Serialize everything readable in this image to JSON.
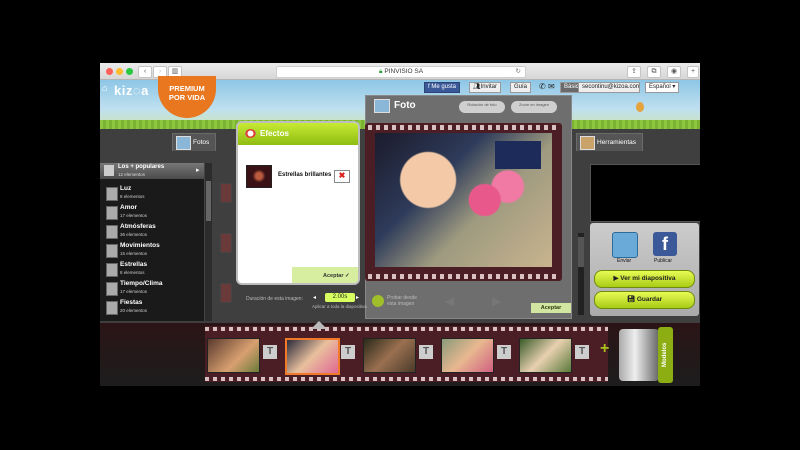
{
  "browser": {
    "url": "PINVISIO SA"
  },
  "site": {
    "logo": "kiz◌a",
    "premium_line1": "PREMIUM",
    "premium_line2": "POR VIDA",
    "toolbar": {
      "fb_like": "Me gusta",
      "invite": "Invitar",
      "guide": "Guía",
      "basic": "Básic",
      "email": "secontinu@kizoa.com",
      "language": "Español"
    }
  },
  "tabs": {
    "fotos": "Fotos",
    "herramientas": "Herramientas"
  },
  "categories": {
    "header_name": "Los + populares",
    "header_count": "12 elementos",
    "items": [
      {
        "name": "Luz",
        "count": "8 elementos"
      },
      {
        "name": "Amor",
        "count": "17 elementos"
      },
      {
        "name": "Atmósferas",
        "count": "36 elementos"
      },
      {
        "name": "Movimientos",
        "count": "15 elementos"
      },
      {
        "name": "Estrellas",
        "count": "8 elementos"
      },
      {
        "name": "Tiempo/Clima",
        "count": "17 elementos"
      },
      {
        "name": "Fiestas",
        "count": "20 elementos"
      }
    ]
  },
  "foto_panel": {
    "title": "Foto",
    "pill1": "Rotación de foto",
    "pill2": "Zoom en imagen",
    "duration_label": "Duración de esta imagen:",
    "duration_value": "2.00s",
    "duration_sub": "Aplicar a toda la diapositiva",
    "preview_text_1": "Probar desde",
    "preview_text_2": "esta imagen",
    "aceptar": "Aceptar"
  },
  "efectos": {
    "title": "Efectos",
    "effect_name": "Estrellas brillantes",
    "remove": "✖",
    "aceptar": "Aceptar"
  },
  "right_panel": {
    "send": "Enviar",
    "publish": "Publicar",
    "fb_glyph": "f",
    "view_btn": "Ver mi diapositiva",
    "save_btn": "Guardar"
  },
  "timeline": {
    "t_glyph": "T",
    "plus": "+",
    "modelos": "Modelos"
  }
}
